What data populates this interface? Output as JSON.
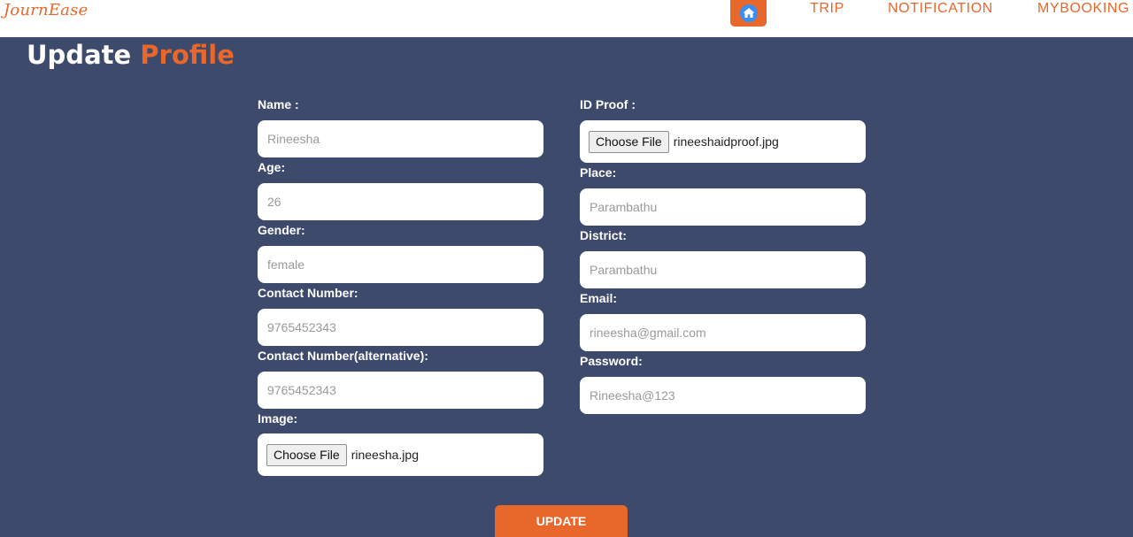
{
  "navbar": {
    "brand": "JournEase",
    "home_icon": "home-icon",
    "links": [
      "TRIP",
      "NOTIFICATION",
      "MYBOOKING"
    ]
  },
  "title": {
    "main": "Update",
    "accent": "Profile"
  },
  "form": {
    "name": {
      "label": "Name :",
      "placeholder": "Rineesha"
    },
    "age": {
      "label": "Age:",
      "placeholder": "26"
    },
    "gender": {
      "label": "Gender:",
      "placeholder": "female"
    },
    "contact": {
      "label": "Contact Number:",
      "placeholder": "9765452343"
    },
    "contact_alt": {
      "label": "Contact Number(alternative):",
      "placeholder": "9765452343"
    },
    "image": {
      "label": "Image:",
      "button": "Choose File",
      "file": "rineesha.jpg"
    },
    "id_proof": {
      "label": "ID Proof :",
      "button": "Choose File",
      "file": "rineeshaidproof.jpg"
    },
    "place": {
      "label": "Place:",
      "placeholder": "Parambathu"
    },
    "district": {
      "label": "District:",
      "placeholder": "Parambathu"
    },
    "email": {
      "label": "Email:",
      "placeholder": "rineesha@gmail.com"
    },
    "password": {
      "label": "Password:",
      "placeholder": "Rineesha@123"
    },
    "submit": "UPDATE"
  },
  "colors": {
    "accent": "#e8672a",
    "background": "#3e4a6b",
    "icon_blue": "#3b8df0"
  }
}
